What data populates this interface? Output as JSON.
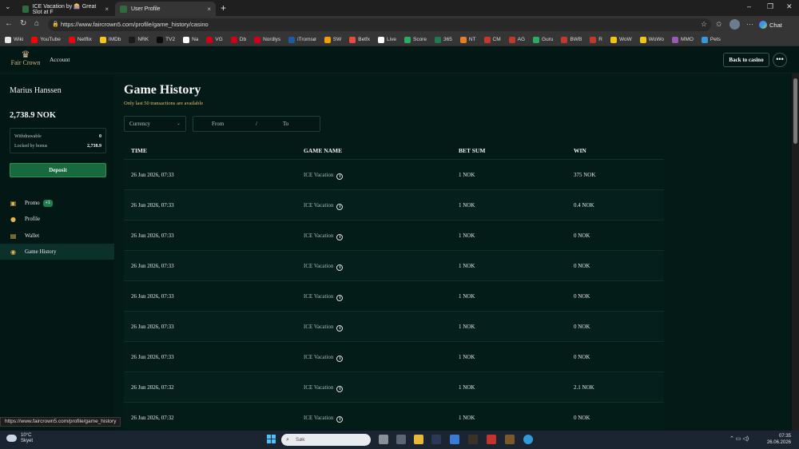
{
  "browser": {
    "tabs": [
      {
        "label": "ICE Vacation by 🎰 Great Slot at F",
        "close": "×"
      },
      {
        "label": "User Profile",
        "close": "×"
      }
    ],
    "new_tab": "+",
    "url": "https://www.faircrown5.com/profile/game_history/casino",
    "chat_label": "Chat",
    "window_controls": {
      "minimize": "–",
      "restore": "❐",
      "close": "✕"
    },
    "bookmarks": [
      {
        "label": "Wiki",
        "color": "#e8e8e8"
      },
      {
        "label": "YouTube",
        "color": "#ff0000"
      },
      {
        "label": "Netflix",
        "color": "#e50914"
      },
      {
        "label": "IMDb",
        "color": "#f5c518"
      },
      {
        "label": "NRK",
        "color": "#1a1a1a"
      },
      {
        "label": "TV2",
        "color": "#0a0a0a"
      },
      {
        "label": "Na",
        "color": "#ffffff"
      },
      {
        "label": "VG",
        "color": "#d0021b"
      },
      {
        "label": "Db",
        "color": "#d0021b"
      },
      {
        "label": "Nordlys",
        "color": "#d0021b"
      },
      {
        "label": "iTromsø",
        "color": "#1e5aa8"
      },
      {
        "label": "SW",
        "color": "#f39c12"
      },
      {
        "label": "Betfx",
        "color": "#e74c3c"
      },
      {
        "label": "Live",
        "color": "#ffffff"
      },
      {
        "label": "Score",
        "color": "#27ae60"
      },
      {
        "label": "365",
        "color": "#1e7b4f"
      },
      {
        "label": "NT",
        "color": "#e67e22"
      },
      {
        "label": "CM",
        "color": "#c0392b"
      },
      {
        "label": "AG",
        "color": "#c0392b"
      },
      {
        "label": "Guru",
        "color": "#27ae60"
      },
      {
        "label": "BWB",
        "color": "#c0392b"
      },
      {
        "label": "R",
        "color": "#c0392b"
      },
      {
        "label": "WoW",
        "color": "#f1c40f"
      },
      {
        "label": "WoWo",
        "color": "#f1c40f"
      },
      {
        "label": "MMO",
        "color": "#9b59b6"
      },
      {
        "label": "Pets",
        "color": "#3498db"
      }
    ],
    "status_url": "https://www.faircrown5.com/profile/game_history"
  },
  "header": {
    "brand": "Fair Crown",
    "account_link": "Account",
    "back_button": "Back to casino",
    "more_button": "•••"
  },
  "sidebar": {
    "user_name": "Marius Hanssen",
    "balance": "2,738.9  NOK",
    "withdrawable_label": "Withdrawable",
    "withdrawable_value": "0",
    "locked_label": "Locked by bonus",
    "locked_value": "2,738.9",
    "deposit_label": "Deposit",
    "nav": [
      {
        "label": "Promo",
        "icon": "gift-icon",
        "badge": "+1"
      },
      {
        "label": "Profile",
        "icon": "user-icon"
      },
      {
        "label": "Wallet",
        "icon": "wallet-icon"
      },
      {
        "label": "Game History",
        "icon": "history-icon",
        "active": true
      }
    ]
  },
  "main": {
    "title": "Game History",
    "subtitle": "Only last 50 transactions are available",
    "currency_placeholder": "Currency",
    "date_from": "From",
    "date_sep": "/",
    "date_to": "To",
    "columns": [
      "TIME",
      "GAME NAME",
      "BET SUM",
      "WIN"
    ],
    "rows": [
      {
        "time": "26 Jun 2026, 07:33",
        "game": "ICE Vacation",
        "bet": "1 NOK",
        "win": "375 NOK"
      },
      {
        "time": "26 Jun 2026, 07:33",
        "game": "ICE Vacation",
        "bet": "1 NOK",
        "win": "0.4 NOK"
      },
      {
        "time": "26 Jun 2026, 07:33",
        "game": "ICE Vacation",
        "bet": "1 NOK",
        "win": "0 NOK"
      },
      {
        "time": "26 Jun 2026, 07:33",
        "game": "ICE Vacation",
        "bet": "1 NOK",
        "win": "0 NOK"
      },
      {
        "time": "26 Jun 2026, 07:33",
        "game": "ICE Vacation",
        "bet": "1 NOK",
        "win": "0 NOK"
      },
      {
        "time": "26 Jun 2026, 07:33",
        "game": "ICE Vacation",
        "bet": "1 NOK",
        "win": "0 NOK"
      },
      {
        "time": "26 Jun 2026, 07:33",
        "game": "ICE Vacation",
        "bet": "1 NOK",
        "win": "0 NOK"
      },
      {
        "time": "26 Jun 2026, 07:32",
        "game": "ICE Vacation",
        "bet": "1 NOK",
        "win": "2.1 NOK"
      },
      {
        "time": "26 Jun 2026, 07:32",
        "game": "ICE Vacation",
        "bet": "1 NOK",
        "win": "0 NOK"
      }
    ]
  },
  "taskbar": {
    "weather_temp": "10°C",
    "weather_desc": "Skyet",
    "search_placeholder": "Søk",
    "time": "07:35",
    "date": "26.06.2026"
  },
  "colors": {
    "background": "#031815",
    "accent_green": "#176a3e",
    "gold": "#d6b98c",
    "subtitle_gold": "#e5c06d"
  }
}
